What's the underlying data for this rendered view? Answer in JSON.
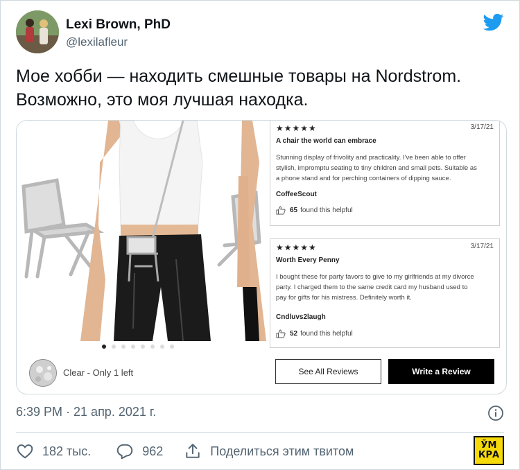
{
  "user": {
    "name": "Lexi Brown, PhD",
    "handle": "@lexilafleur"
  },
  "tweet": {
    "line1": "Мое хобби — находить смешные товары на Nordstrom.",
    "line2": "Возможно, это моя лучшая находка."
  },
  "product": {
    "color_label": "Clear - Only 1 left",
    "carousel_dots": 8,
    "carousel_active_index": 0
  },
  "reviews": [
    {
      "stars": "★★★★★",
      "date": "3/17/21",
      "title": "A chair the world can embrace",
      "body_lines": [
        "Stunning display of frivolity and practicality. I've been able to offer",
        "stylish, impromptu  seating to tiny children and small pets. Suitable as",
        "a phone stand and for perching containers of dipping sauce."
      ],
      "author": "CoffeeScout",
      "helpful_count": "65",
      "helpful_text": "found this helpful"
    },
    {
      "stars": "★★★★★",
      "date": "3/17/21",
      "title": "Worth Every Penny",
      "body_lines": [
        "I bought these for party favors to give to my girlfriends at my divorce",
        "party.  I charged them to the same credit card my husband used to",
        "pay for gifts for his mistress.  Definitely worth it."
      ],
      "author": "Cndluvs2laugh",
      "helpful_count": "52",
      "helpful_text": "found this helpful"
    }
  ],
  "buttons": {
    "see_all": "See All Reviews",
    "write": "Write a Review"
  },
  "meta": {
    "timestamp": "6:39 PM · 21 апр. 2021 г."
  },
  "actions": {
    "likes": "182 тыс.",
    "replies": "962",
    "share": "Поделиться этим твитом"
  },
  "logo": {
    "top": "ЎМ",
    "bottom": "КРА"
  },
  "colors": {
    "twitter_blue": "#1d9bf0",
    "secondary_text": "#536471",
    "border": "#cfd9de",
    "logo_yellow": "#f5d90a"
  },
  "icons": [
    "twitter-bird-icon",
    "info-icon",
    "heart-icon",
    "reply-icon",
    "share-icon",
    "thumbs-up-icon"
  ]
}
